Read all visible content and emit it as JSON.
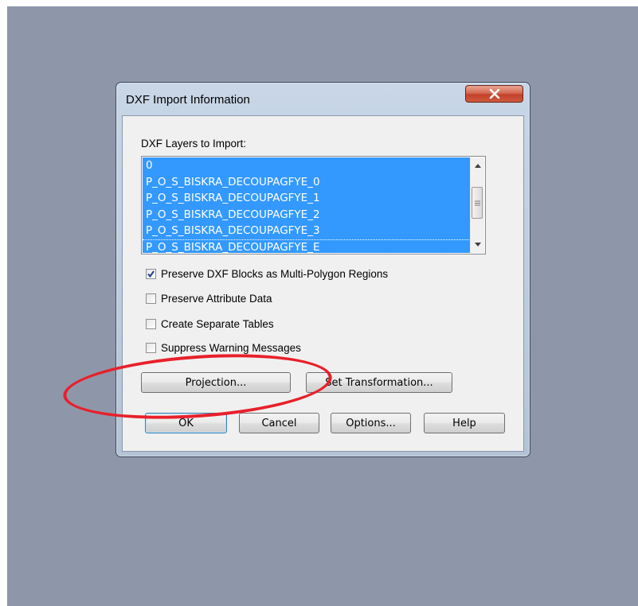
{
  "dialog": {
    "title": "DXF Import Information",
    "layers_label": "DXF Layers to Import:",
    "layers": [
      "0",
      "P_O_S_BISKRA_DECOUPAGFYE_0",
      "P_O_S_BISKRA_DECOUPAGFYE_1",
      "P_O_S_BISKRA_DECOUPAGFYE_2",
      "P_O_S_BISKRA_DECOUPAGFYE_3",
      "P_O_S_BISKRA_DECOUPAGFYE_E"
    ],
    "options": [
      {
        "label": "Preserve DXF Blocks as Multi-Polygon Regions",
        "checked": true
      },
      {
        "label": "Preserve Attribute Data",
        "checked": false
      },
      {
        "label": "Create Separate Tables",
        "checked": false
      },
      {
        "label": "Suppress Warning Messages",
        "checked": false
      }
    ],
    "buttons": {
      "projection": "Projection...",
      "transformation": "Set Transformation...",
      "ok": "OK",
      "cancel": "Cancel",
      "options": "Options...",
      "help": "Help"
    }
  },
  "colors": {
    "backdrop": "#8e97aa",
    "selection": "#3399ff",
    "annotation": "#e8202a",
    "close_button": "#c3412a"
  },
  "icons": [
    "close-icon",
    "scroll-up-arrow-icon",
    "scroll-down-arrow-icon",
    "checkmark-icon"
  ]
}
